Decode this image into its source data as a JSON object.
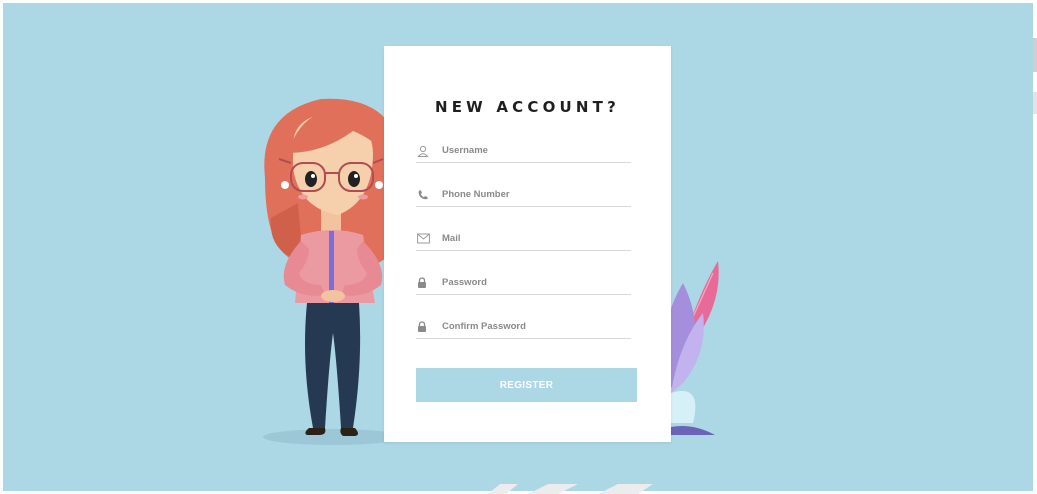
{
  "form": {
    "title": "NEW ACCOUNT?",
    "fields": [
      {
        "placeholder": "Username",
        "icon": "user-icon"
      },
      {
        "placeholder": "Phone Number",
        "icon": "phone-icon"
      },
      {
        "placeholder": "Mail",
        "icon": "mail-icon"
      },
      {
        "placeholder": "Password",
        "icon": "lock-icon"
      },
      {
        "placeholder": "Confirm Password",
        "icon": "lock-icon"
      }
    ],
    "submit_label": "REGISTER"
  },
  "colors": {
    "background": "#acd7e5",
    "card": "#ffffff",
    "button": "#acd7e5",
    "hair": "#e0705a",
    "pants": "#253a52",
    "leaf_pink": "#e86b97",
    "leaf_purple": "#a58fdc"
  }
}
